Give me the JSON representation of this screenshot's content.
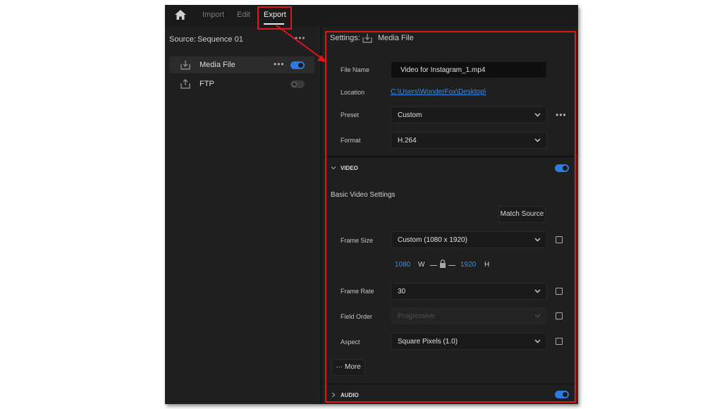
{
  "topbar": {
    "home_icon": "home-icon",
    "tabs": [
      {
        "label": "Import",
        "active": false
      },
      {
        "label": "Edit",
        "active": false
      },
      {
        "label": "Export",
        "active": true
      }
    ]
  },
  "sidebar": {
    "source_label": "Source:",
    "source_value": "Sequence 01",
    "more_label": "•••",
    "destinations": [
      {
        "label": "Media File",
        "icon": "download-icon",
        "enabled": true,
        "more": "•••"
      },
      {
        "label": "FTP",
        "icon": "upload-icon",
        "enabled": false
      }
    ]
  },
  "settings": {
    "header_label": "Settings:",
    "header_target": "Media File",
    "file_name_label": "File Name",
    "file_name_value": "Video for Instagram_1.mp4",
    "location_label": "Location",
    "location_value": "C:\\Users\\WonderFox\\Desktop\\",
    "preset_label": "Preset",
    "preset_value": "Custom",
    "preset_more": "•••",
    "format_label": "Format",
    "format_value": "H.264"
  },
  "video": {
    "section_title": "VIDEO",
    "enabled": true,
    "basic_title": "Basic Video Settings",
    "match_source_label": "Match Source",
    "frame_size_label": "Frame Size",
    "frame_size_value": "Custom (1080 x 1920)",
    "width_value": "1080",
    "width_letter": "W",
    "height_value": "1920",
    "height_letter": "H",
    "frame_rate_label": "Frame Rate",
    "frame_rate_value": "30",
    "field_order_label": "Field Order",
    "field_order_value": "Progressive",
    "aspect_label": "Aspect",
    "aspect_value": "Square Pixels (1.0)",
    "more_label": "··· More"
  },
  "audio": {
    "section_title": "AUDIO",
    "enabled": true
  },
  "colors": {
    "accent": "#2d7be0",
    "link": "#3d8ee8",
    "annotation": "#e0161c",
    "panel_bg": "#1f1f1f"
  }
}
